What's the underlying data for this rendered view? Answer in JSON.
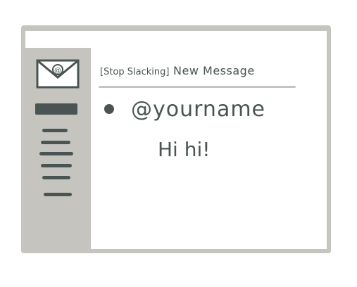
{
  "window": {
    "colors": {
      "frame": "#c6c4bf",
      "ink": "#4a5553",
      "background": "#ffffff"
    }
  },
  "titlebar": {
    "url_bar": "",
    "icons": [
      "tab-pill-icon",
      "window-dot-icon"
    ]
  },
  "sidebar": {
    "logo_icon": "mail-envelope-icon",
    "items": [
      {
        "state": "active"
      },
      {
        "state": "inactive"
      },
      {
        "state": "inactive"
      },
      {
        "state": "inactive"
      },
      {
        "state": "inactive"
      },
      {
        "state": "inactive"
      }
    ]
  },
  "compose": {
    "tag": "[Stop Slacking]",
    "title": "New Message",
    "to": "@yourname",
    "body": "Hi hi!"
  }
}
